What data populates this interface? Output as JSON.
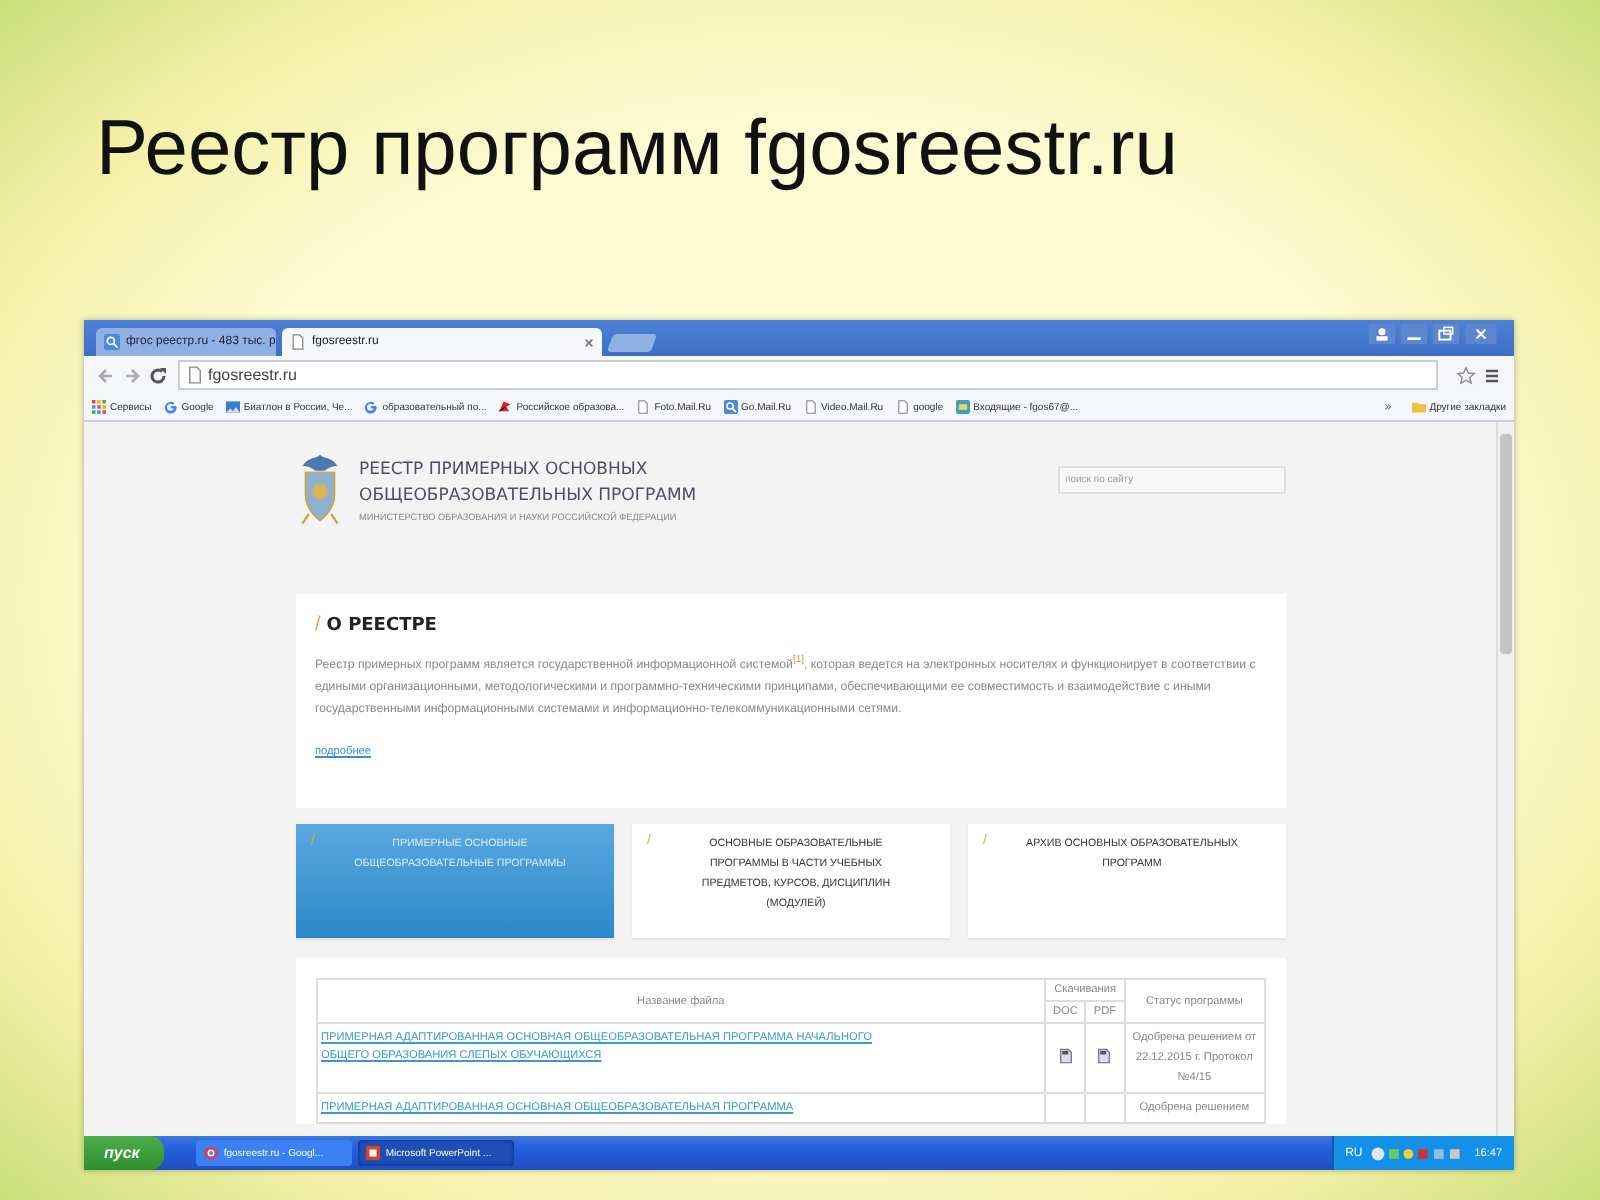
{
  "slide_title": "Реестр программ fgosreestr.ru",
  "browser": {
    "tabs": [
      {
        "label": "фгос реестр.ru - 483 тыс. р",
        "kind": "search",
        "selected": false
      },
      {
        "label": "fgosreestr.ru",
        "kind": "page",
        "selected": true
      }
    ],
    "address": "fgosreestr.ru",
    "bookmarks": [
      {
        "label": "Сервисы",
        "kind": "apps"
      },
      {
        "label": "Google",
        "kind": "google"
      },
      {
        "label": "Биатлон в России, Че...",
        "kind": "image"
      },
      {
        "label": "образовательный по...",
        "kind": "google"
      },
      {
        "label": "Российское образова...",
        "kind": "flag"
      },
      {
        "label": "Foto.Mail.Ru",
        "kind": "page"
      },
      {
        "label": "Go.Mail.Ru",
        "kind": "search"
      },
      {
        "label": "Video.Mail.Ru",
        "kind": "page"
      },
      {
        "label": "google",
        "kind": "page"
      },
      {
        "label": "Входящие - fgos67@...",
        "kind": "mail"
      }
    ],
    "more": "»",
    "other_bookmarks": "Другие закладки"
  },
  "site": {
    "title_lines": [
      "РЕЕСТР ПРИМЕРНЫХ ОСНОВНЫХ",
      "ОБЩЕОБРАЗОВАТЕЛЬНЫХ ПРОГРАММ"
    ],
    "subtitle": "МИНИСТЕРСТВО ОБРАЗОВАНИЯ И НАУКИ РОССИЙСКОЙ ФЕДЕРАЦИИ",
    "search_placeholder": "поиск по сайту",
    "about": {
      "slash": "/",
      "heading": "О РЕЕСТРЕ",
      "text": "Реестр примерных программ является государственной информационной системой$^{[1]}$, которая ведется на электронных носителях и функционирует в соответствии с едиными организационными, методологическими и программно-техническими принципами, обеспечивающими ее совместимость и взаимодействие с иными государственными информационными системами и информационно-телекоммуникационными сетями.",
      "more": "подробнее"
    },
    "tiles": [
      {
        "slash": "/",
        "label": "ПРИМЕРНЫЕ ОСНОВНЫЕ ОБЩЕОБРАЗОВАТЕЛЬНЫЕ ПРОГРАММЫ",
        "selected": true
      },
      {
        "slash": "/",
        "label": "ОСНОВНЫЕ ОБРАЗОВАТЕЛЬНЫЕ ПРОГРАММЫ В ЧАСТИ УЧЕБНЫХ ПРЕДМЕТОВ, КУРСОВ, ДИСЦИПЛИН (МОДУЛЕЙ)",
        "selected": false
      },
      {
        "slash": "/",
        "label": "АРХИВ ОСНОВНЫХ ОБРАЗОВАТЕЛЬНЫХ ПРОГРАММ",
        "selected": false
      }
    ],
    "table": {
      "columns": {
        "name": "Название файла",
        "downloads": "Скачивания",
        "doc": "DOC",
        "pdf": "PDF",
        "status": "Статус программы"
      },
      "rows": [
        {
          "name": "ПРИМЕРНАЯ АДАПТИРОВАННАЯ ОСНОВНАЯ ОБЩЕОБРАЗОВАТЕЛЬНАЯ ПРОГРАММА НАЧАЛЬНОГО ОБЩЕГО ОБРАЗОВАНИЯ СЛЕПЫХ ОБУЧАЮЩИХСЯ",
          "doc_file": true,
          "pdf_file": true,
          "status": "Одобрена решением от 22.12.2015 г. Протокол №4/15"
        },
        {
          "name": "ПРИМЕРНАЯ АДАПТИРОВАННАЯ ОСНОВНАЯ ОБЩЕОБРАЗОВАТЕЛЬНАЯ ПРОГРАММА",
          "status": "Одобрена решением"
        }
      ]
    }
  },
  "taskbar": {
    "start": "пуск",
    "tasks": [
      {
        "label": "fgosreestr.ru - Googl...",
        "kind": "browser",
        "selected": false
      },
      {
        "label": "Microsoft PowerPoint ...",
        "kind": "slides",
        "selected": true
      }
    ],
    "language": "RU",
    "time": "16:47"
  }
}
